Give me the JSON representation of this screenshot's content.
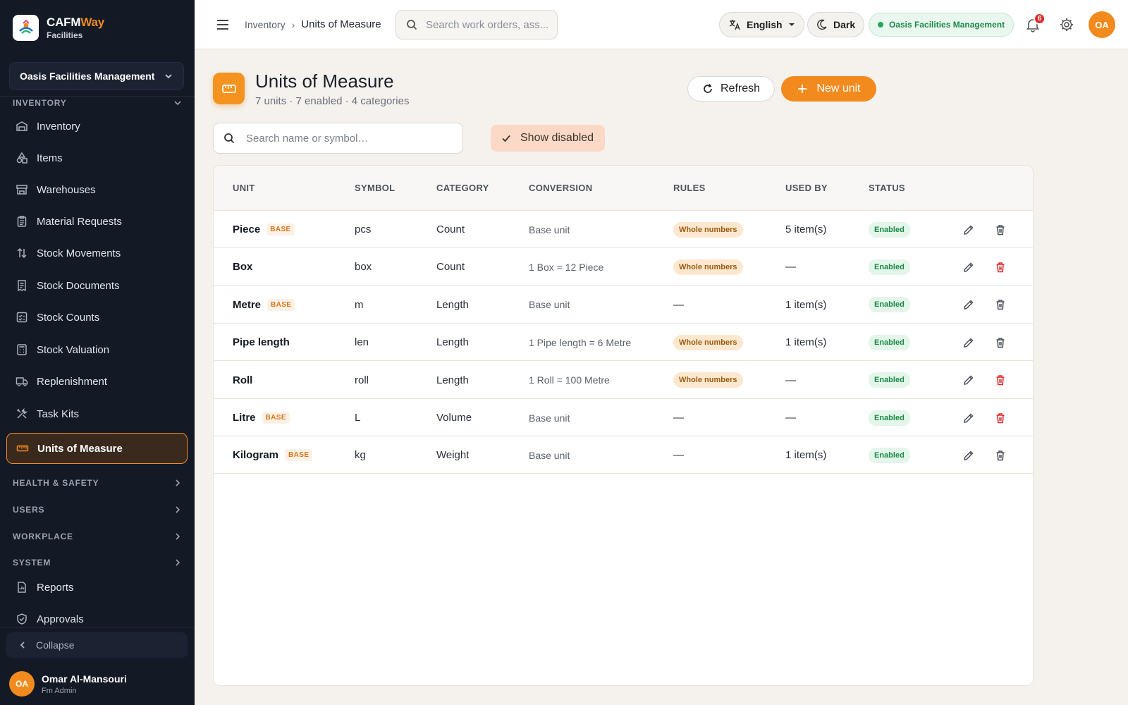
{
  "brand": {
    "name_a": "CAFM",
    "name_b": "Way",
    "sub": "Facilities"
  },
  "sidebar": {
    "org": "Oasis Facilities Management",
    "sections": {
      "inventory": "INVENTORY",
      "health": "HEALTH & SAFETY",
      "users": "USERS",
      "workplace": "WORKPLACE",
      "system": "SYSTEM"
    },
    "items": [
      {
        "label": "Inventory",
        "icon": "warehouse-icon"
      },
      {
        "label": "Items",
        "icon": "shapes-icon"
      },
      {
        "label": "Warehouses",
        "icon": "store-icon"
      },
      {
        "label": "Material Requests",
        "icon": "clipboard-icon"
      },
      {
        "label": "Stock Movements",
        "icon": "arrows-icon"
      },
      {
        "label": "Stock Documents",
        "icon": "receipt-icon"
      },
      {
        "label": "Stock Counts",
        "icon": "checklist-icon"
      },
      {
        "label": "Stock Valuation",
        "icon": "calculator-icon"
      },
      {
        "label": "Replenishment",
        "icon": "truck-icon"
      },
      {
        "label": "Task Kits",
        "icon": "tools-icon"
      },
      {
        "label": "Units of Measure",
        "icon": "ruler-icon"
      }
    ],
    "system_items": [
      {
        "label": "Reports",
        "icon": "report-icon"
      },
      {
        "label": "Approvals",
        "icon": "shield-check-icon"
      }
    ],
    "collapse": "Collapse",
    "user": {
      "initials": "OA",
      "name": "Omar Al-Mansouri",
      "role": "Fm Admin"
    }
  },
  "topbar": {
    "breadcrumb": {
      "parent": "Inventory",
      "current": "Units of Measure"
    },
    "search_placeholder": "Search work orders, ass...",
    "language": "English",
    "theme": "Dark",
    "org": "Oasis Facilities Management",
    "notifications": "6",
    "avatar": "OA"
  },
  "page": {
    "title": "Units of Measure",
    "subtitle": "7 units · 7 enabled · 4 categories",
    "refresh": "Refresh",
    "new_unit": "New unit",
    "search_placeholder": "Search name or symbol…",
    "show_disabled": "Show disabled"
  },
  "table": {
    "columns": [
      "UNIT",
      "SYMBOL",
      "CATEGORY",
      "CONVERSION",
      "RULES",
      "USED BY",
      "STATUS"
    ],
    "base_label": "BASE",
    "rows": [
      {
        "unit": "Piece",
        "base": true,
        "symbol": "pcs",
        "category": "Count",
        "conversion": "Base unit",
        "rules": "Whole numbers",
        "used_by": "5 item(s)",
        "status": "Enabled",
        "delete_red": false
      },
      {
        "unit": "Box",
        "base": false,
        "symbol": "box",
        "category": "Count",
        "conversion": "1 Box = 12 Piece",
        "rules": "Whole numbers",
        "used_by": "—",
        "status": "Enabled",
        "delete_red": true
      },
      {
        "unit": "Metre",
        "base": true,
        "symbol": "m",
        "category": "Length",
        "conversion": "Base unit",
        "rules": "—",
        "used_by": "1 item(s)",
        "status": "Enabled",
        "delete_red": false
      },
      {
        "unit": "Pipe length",
        "base": false,
        "symbol": "len",
        "category": "Length",
        "conversion": "1 Pipe length = 6 Metre",
        "rules": "Whole numbers",
        "used_by": "1 item(s)",
        "status": "Enabled",
        "delete_red": false
      },
      {
        "unit": "Roll",
        "base": false,
        "symbol": "roll",
        "category": "Length",
        "conversion": "1 Roll = 100 Metre",
        "rules": "Whole numbers",
        "used_by": "—",
        "status": "Enabled",
        "delete_red": true
      },
      {
        "unit": "Litre",
        "base": true,
        "symbol": "L",
        "category": "Volume",
        "conversion": "Base unit",
        "rules": "—",
        "used_by": "—",
        "status": "Enabled",
        "delete_red": true
      },
      {
        "unit": "Kilogram",
        "base": true,
        "symbol": "kg",
        "category": "Weight",
        "conversion": "Base unit",
        "rules": "—",
        "used_by": "1 item(s)",
        "status": "Enabled",
        "delete_red": false
      }
    ]
  },
  "colors": {
    "accent": "#f28a1e",
    "sidebar": "#131a26",
    "success": "#1c8a48",
    "danger": "#dc2c2c"
  }
}
